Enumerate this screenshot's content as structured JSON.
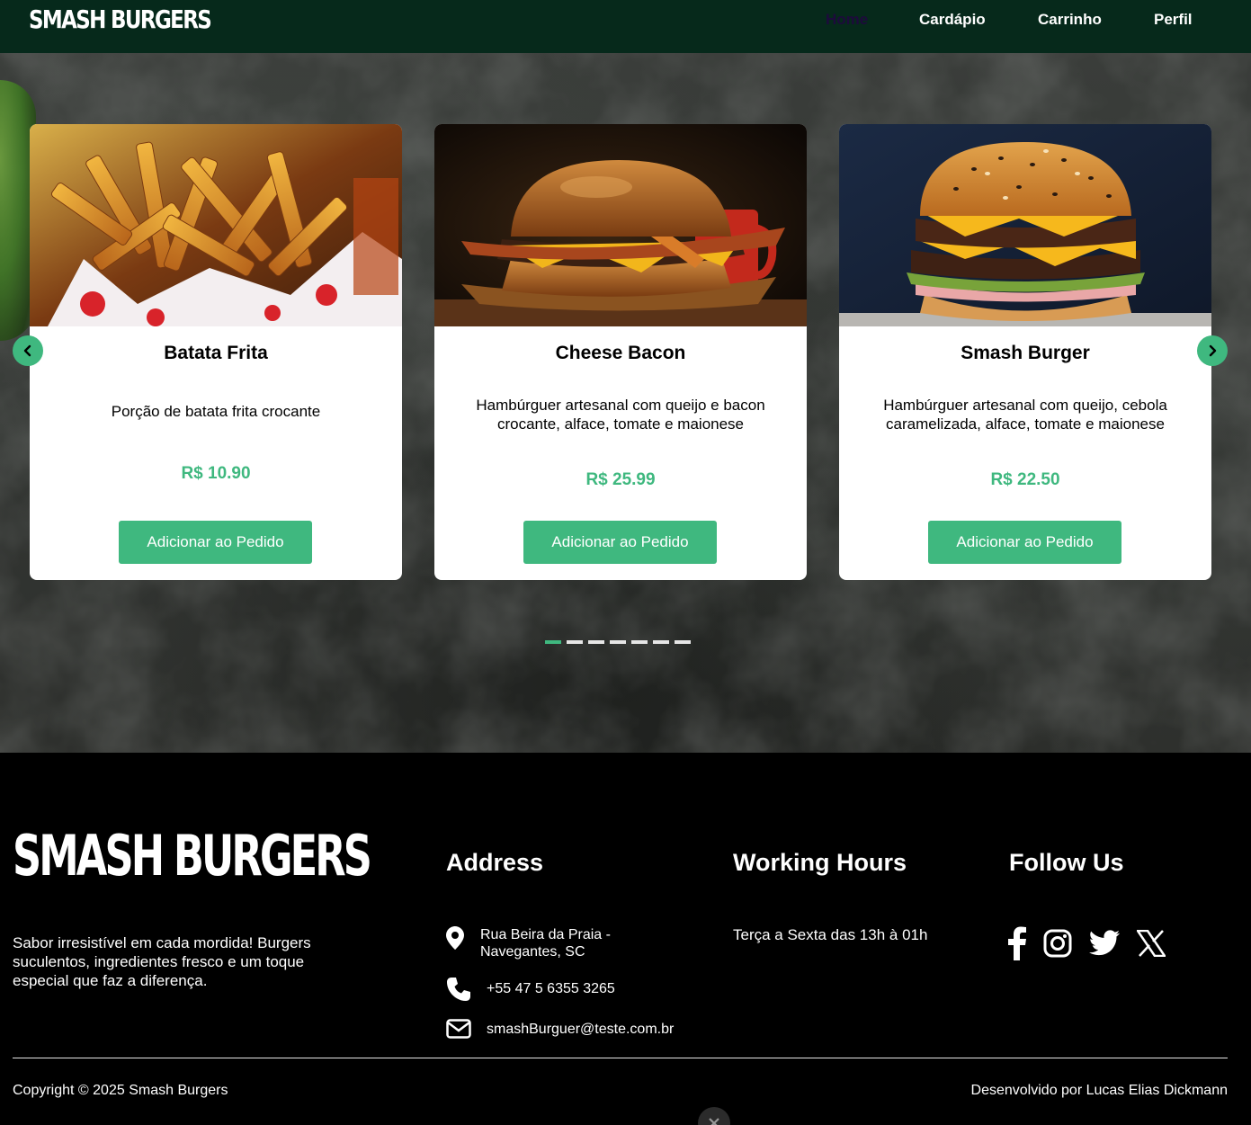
{
  "header": {
    "brand": "SMASH BURGERS",
    "nav": [
      {
        "label": "Home",
        "active": true
      },
      {
        "label": "Cardápio"
      },
      {
        "label": "Carrinho"
      },
      {
        "label": "Perfil"
      }
    ]
  },
  "carousel": {
    "cards": [
      {
        "title": "Batata Frita",
        "description": "Porção de batata frita crocante",
        "price": "R$ 10.90",
        "button": "Adicionar ao Pedido",
        "image": "fries-photo"
      },
      {
        "title": "Cheese Bacon",
        "description": "Hambúrguer artesanal com queijo e bacon crocante, alface, tomate e maionese",
        "price": "R$ 25.99",
        "button": "Adicionar ao Pedido",
        "image": "cheese-bacon-burger-photo"
      },
      {
        "title": "Smash Burger",
        "description": "Hambúrguer artesanal com queijo, cebola caramelizada, alface, tomate e maionese",
        "price": "R$ 22.50",
        "button": "Adicionar ao Pedido",
        "image": "double-smash-burger-photo"
      }
    ],
    "pagination_count": 7,
    "active_page": 1,
    "accent": "#3fb87f"
  },
  "footer": {
    "logo": "SMASH BURGERS",
    "about": "Sabor irresistível em cada mordida! Burgers suculentos, ingredientes fresco e um toque especial que faz a diferença.",
    "address_heading": "Address",
    "address": "Rua Beira da Praia - Navegantes, SC",
    "phone": "+55 47 5 6355 3265",
    "email": "smashBurguer@teste.com.br",
    "hours_heading": "Working Hours",
    "hours": "Terça a Sexta das 13h à 01h",
    "follow_heading": "Follow Us",
    "socials": [
      "facebook-icon",
      "instagram-icon",
      "twitter-icon",
      "x-icon"
    ],
    "copyright": "Copyright © 2025 Smash Burgers",
    "developer": "Desenvolvido por Lucas Elias Dickmann"
  },
  "colors": {
    "header_bg": "#06291b",
    "accent": "#3fb87f",
    "footer_bg": "#000000"
  }
}
